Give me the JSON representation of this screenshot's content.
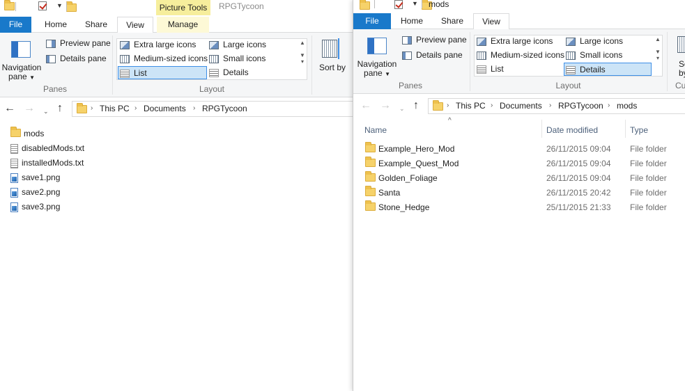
{
  "left_window": {
    "title": "RPGTycoon",
    "contextual_tab_header": "Picture Tools",
    "tabs": [
      "File",
      "Home",
      "Share",
      "View",
      "Manage"
    ],
    "ribbon": {
      "navigation_pane_label": "Navigation pane",
      "preview_pane_label": "Preview pane",
      "details_pane_label": "Details pane",
      "panes_group_label": "Panes",
      "layout_items": [
        "Extra large icons",
        "Large icons",
        "Medium-sized icons",
        "Small icons",
        "List",
        "Details"
      ],
      "layout_group_label": "Layout",
      "selected_layout": "List",
      "sort_label": "Sort by"
    },
    "breadcrumb": [
      "This PC",
      "Documents",
      "RPGTycoon"
    ],
    "files": [
      {
        "name": "mods",
        "type": "folder"
      },
      {
        "name": "disabledMods.txt",
        "type": "txt"
      },
      {
        "name": "installedMods.txt",
        "type": "txt"
      },
      {
        "name": "save1.png",
        "type": "png"
      },
      {
        "name": "save2.png",
        "type": "png"
      },
      {
        "name": "save3.png",
        "type": "png"
      }
    ]
  },
  "right_window": {
    "title": "mods",
    "tabs": [
      "File",
      "Home",
      "Share",
      "View"
    ],
    "ribbon": {
      "navigation_pane_label": "Navigation pane",
      "preview_pane_label": "Preview pane",
      "details_pane_label": "Details pane",
      "panes_group_label": "Panes",
      "layout_items": [
        "Extra large icons",
        "Large icons",
        "Medium-sized icons",
        "Small icons",
        "List",
        "Details"
      ],
      "layout_group_label": "Layout",
      "selected_layout": "Details",
      "sort_label_partial": "So by",
      "cut_group_label_partial": "Cu"
    },
    "breadcrumb": [
      "This PC",
      "Documents",
      "RPGTycoon",
      "mods"
    ],
    "columns": [
      "Name",
      "Date modified",
      "Type"
    ],
    "rows": [
      {
        "name": "Example_Hero_Mod",
        "date": "26/11/2015 09:04",
        "type": "File folder"
      },
      {
        "name": "Example_Quest_Mod",
        "date": "26/11/2015 09:04",
        "type": "File folder"
      },
      {
        "name": "Golden_Foliage",
        "date": "26/11/2015 09:04",
        "type": "File folder"
      },
      {
        "name": "Santa",
        "date": "26/11/2015 20:42",
        "type": "File folder"
      },
      {
        "name": "Stone_Hedge",
        "date": "25/11/2015 21:33",
        "type": "File folder"
      }
    ]
  },
  "colors": {
    "file_tab": "#1979ca",
    "contextual_header": "#f6ee9c",
    "selected_item_bg": "#cce4f7",
    "selected_item_border": "#3d8ee6",
    "folder": "#f6d26a"
  },
  "icons": [
    "folder-icon",
    "checkbox-icon",
    "navigation-pane-icon",
    "preview-pane-icon",
    "details-pane-icon",
    "layout-icon",
    "back-arrow-icon",
    "forward-arrow-icon",
    "up-arrow-icon",
    "chevron-right-icon",
    "txt-file-icon",
    "png-file-icon",
    "sort-icon"
  ]
}
